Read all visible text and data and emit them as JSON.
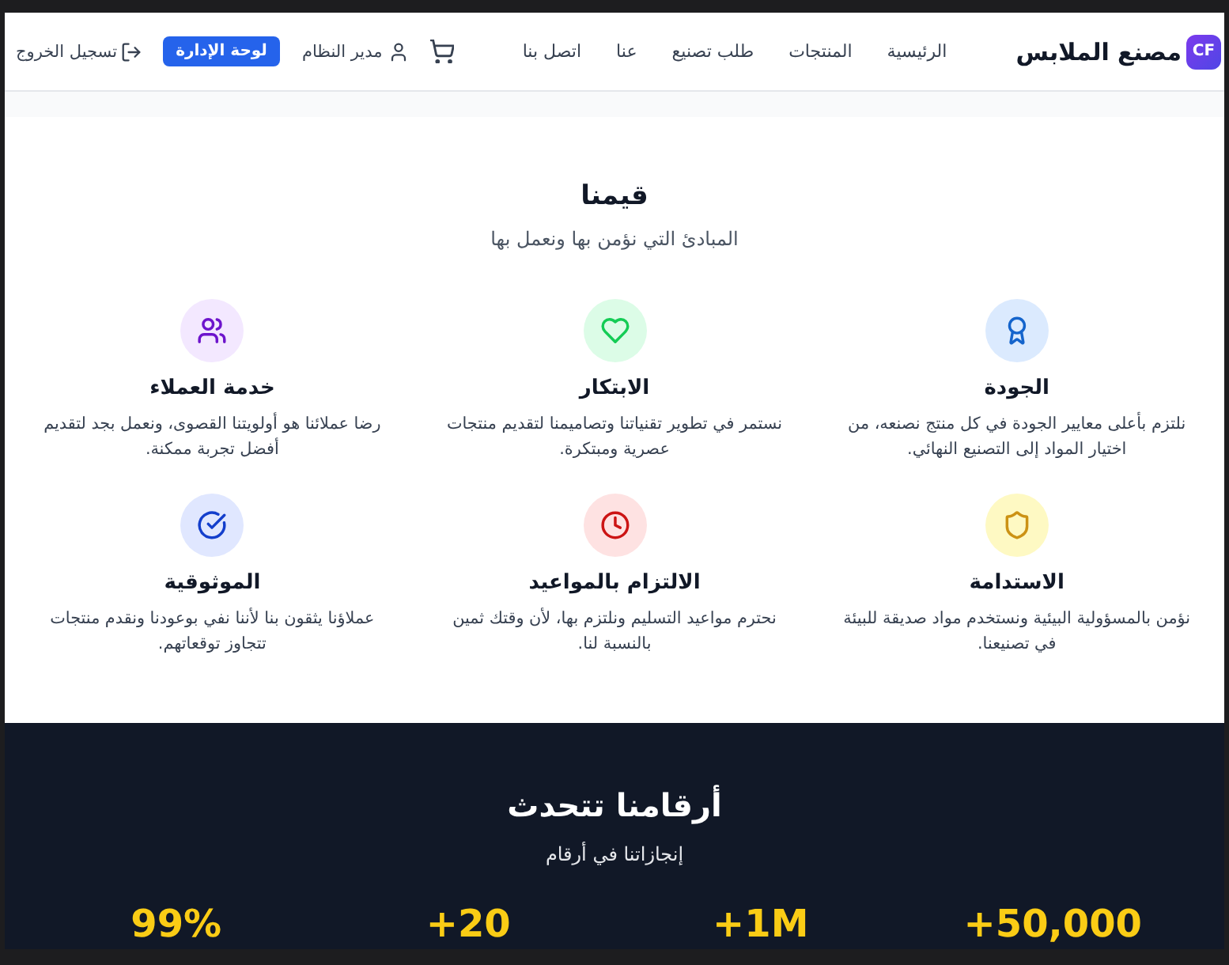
{
  "header": {
    "logo_badge": "CF",
    "site_name": "مصنع الملابس",
    "nav": [
      "الرئيسية",
      "المنتجات",
      "طلب تصنيع",
      "عنا",
      "اتصل بنا"
    ],
    "user_name": "مدير النظام",
    "admin_button": "لوحة الإدارة",
    "logout": "تسجيل الخروج"
  },
  "values": {
    "title": "قيمنا",
    "subtitle": "المبادئ التي نؤمن بها ونعمل بها",
    "items": [
      {
        "title": "الجودة",
        "description": "نلتزم بأعلى معايير الجودة في كل منتج نصنعه، من اختيار المواد إلى التصنيع النهائي.",
        "color": "#dbeafe"
      },
      {
        "title": "الابتكار",
        "description": "نستمر في تطوير تقنياتنا وتصاميمنا لتقديم منتجات عصرية ومبتكرة.",
        "color": "#dcfce7"
      },
      {
        "title": "خدمة العملاء",
        "description": "رضا عملائنا هو أولويتنا القصوى، ونعمل بجد لتقديم أفضل تجربة ممكنة.",
        "color": "#f3e8ff"
      },
      {
        "title": "الاستدامة",
        "description": "نؤمن بالمسؤولية البيئية ونستخدم مواد صديقة للبيئة في تصنيعنا.",
        "color": "#fef9c3"
      },
      {
        "title": "الالتزام بالمواعيد",
        "description": "نحترم مواعيد التسليم ونلتزم بها، لأن وقتك ثمين بالنسبة لنا.",
        "color": "#fee2e2"
      },
      {
        "title": "الموثوقية",
        "description": "عملاؤنا يثقون بنا لأننا نفي بوعودنا ونقدم منتجات تتجاوز توقعاتهم.",
        "color": "#e0e7ff"
      }
    ]
  },
  "stats": {
    "title": "أرقامنا تتحدث",
    "subtitle": "إنجازاتنا في أرقام",
    "items": [
      "+50,000",
      "+1M",
      "+20",
      "99%"
    ]
  }
}
